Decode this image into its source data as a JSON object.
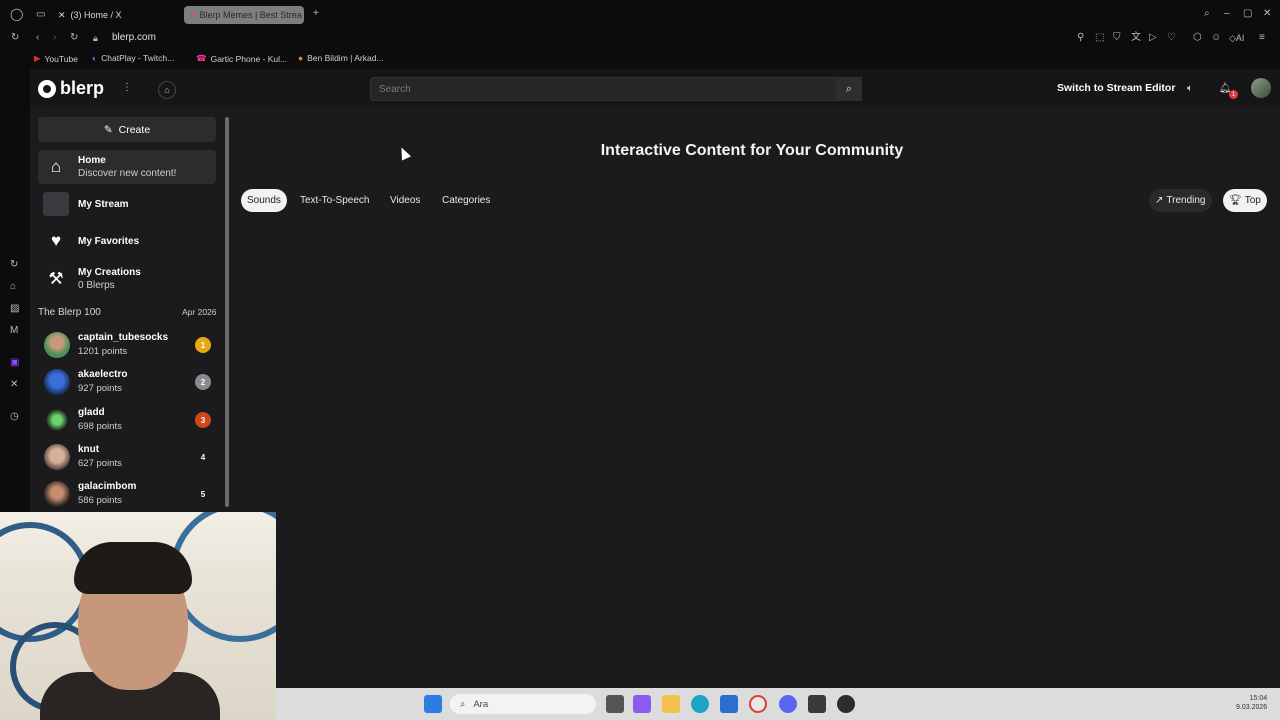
{
  "browser": {
    "tabs": [
      {
        "title": "(3) Home / X",
        "icon": "x-logo-icon"
      },
      {
        "title": "Blerp Memes | Best Strea",
        "icon": "blerp-icon",
        "active": true
      }
    ],
    "url": "blerp.com",
    "bookmarks": [
      {
        "label": "YouTube",
        "icon": "youtube-icon"
      },
      {
        "label": "ChatPlay - Twitch...",
        "icon": "chatplay-icon"
      },
      {
        "label": "Gartic Phone - Kul...",
        "icon": "gartic-icon"
      },
      {
        "label": "Ben Bildim | Arkad...",
        "icon": "benbildim-icon"
      }
    ],
    "ai_label": "AI"
  },
  "header": {
    "logo_text": "blerp",
    "search_placeholder": "Search",
    "switch_label": "Switch to Stream Editor",
    "notification_count": "1"
  },
  "sidebar": {
    "create_label": "Create",
    "nav": [
      {
        "label": "Home",
        "sub": "Discover new content!",
        "icon": "home-icon"
      },
      {
        "label": "My Stream",
        "sub": "",
        "icon": "stream-thumbnail-icon"
      },
      {
        "label": "My Favorites",
        "sub": "",
        "icon": "heart-icon"
      },
      {
        "label": "My Creations",
        "sub": "0 Blerps",
        "icon": "hammer-icon"
      }
    ],
    "leaderboard_title": "The Blerp 100",
    "leaderboard_date": "Apr 2026",
    "leaderboard": [
      {
        "name": "captain_tubesocks",
        "points": "1201 points",
        "rank": "1",
        "badge_color": "#e8a814"
      },
      {
        "name": "akaelectro",
        "points": "927 points",
        "rank": "2",
        "badge_color": "#8b8b8f"
      },
      {
        "name": "gladd",
        "points": "698 points",
        "rank": "3",
        "badge_color": "#d2461a"
      },
      {
        "name": "knut",
        "points": "627 points",
        "rank": "4",
        "badge_color": "transparent"
      },
      {
        "name": "galacimbom",
        "points": "586 points",
        "rank": "5",
        "badge_color": "transparent"
      }
    ]
  },
  "main": {
    "title": "Interactive Content for Your Community",
    "filters": [
      "Sounds",
      "Text-To-Speech",
      "Videos",
      "Categories"
    ],
    "selected_filter": "Sounds",
    "sorts": [
      {
        "label": "Trending",
        "icon": "trending-icon"
      },
      {
        "label": "Top",
        "icon": "trophy-icon"
      }
    ],
    "selected_sort": "Top"
  },
  "taskbar": {
    "search_label": "Ara",
    "time": "15:04",
    "date": "9.03.2026"
  },
  "colors": {
    "background": "#1b1b1d",
    "panel": "#2c2c2f",
    "accent_red": "#e23b3b"
  }
}
